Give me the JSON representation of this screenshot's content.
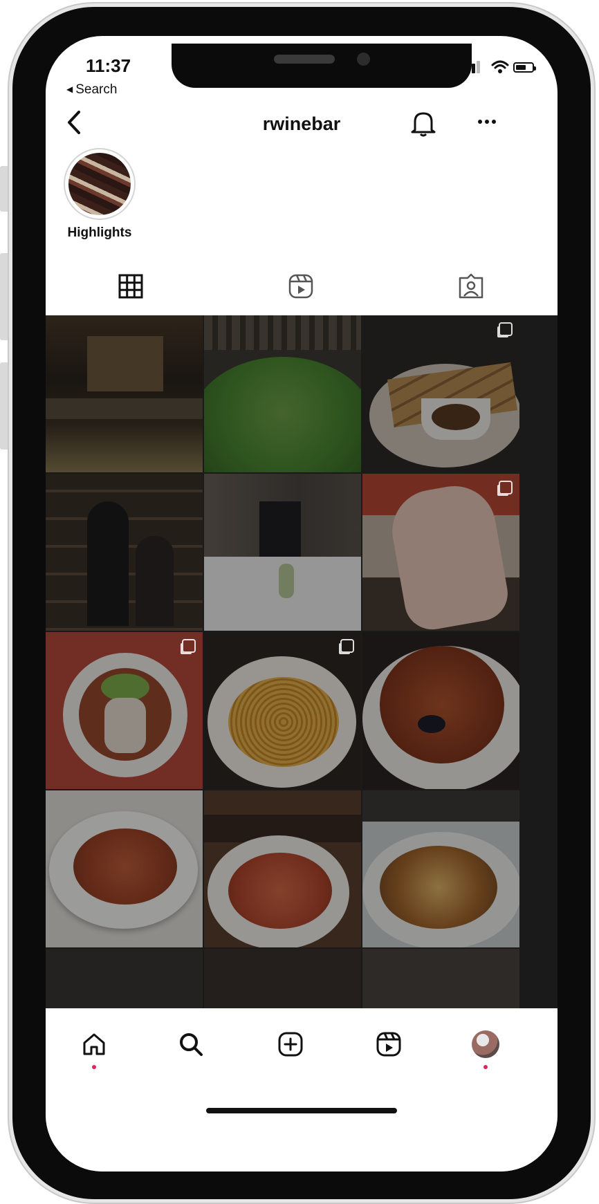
{
  "status_bar": {
    "time": "11:37",
    "back_app": "Search"
  },
  "header": {
    "username": "rwinebar",
    "icons": [
      "chevron-left-icon",
      "bell-icon",
      "more-icon"
    ]
  },
  "highlights": [
    {
      "label": "Highlights"
    }
  ],
  "tabs": [
    {
      "name": "posts-grid",
      "icon": "grid-icon",
      "selected": true
    },
    {
      "name": "reels",
      "icon": "reels-icon",
      "selected": false
    },
    {
      "name": "tagged",
      "icon": "tagged-icon",
      "selected": false
    }
  ],
  "grid_posts": [
    {
      "subject": "restaurant-dining-room",
      "multi": false
    },
    {
      "subject": "microgreens",
      "multi": false
    },
    {
      "subject": "bread-and-dip",
      "multi": true
    },
    {
      "subject": "live-music-singer",
      "multi": false
    },
    {
      "subject": "snowy-storefront",
      "multi": false
    },
    {
      "subject": "fork-in-hand",
      "multi": true
    },
    {
      "subject": "soup-bowl",
      "multi": true
    },
    {
      "subject": "spaghetti",
      "multi": true
    },
    {
      "subject": "seafood-pasta",
      "multi": false
    },
    {
      "subject": "pasta-plate",
      "multi": false
    },
    {
      "subject": "tomato-pasta",
      "multi": false
    },
    {
      "subject": "gnocchi",
      "multi": false
    }
  ],
  "bottom_nav": [
    {
      "icon": "home-icon",
      "active": true
    },
    {
      "icon": "search-icon",
      "active": false
    },
    {
      "icon": "add-post-icon",
      "active": false
    },
    {
      "icon": "reels-icon",
      "active": false
    },
    {
      "icon": "profile-avatar",
      "active": false
    }
  ],
  "colors": {
    "notification_dot": "#e0245e",
    "text": "#111111"
  }
}
